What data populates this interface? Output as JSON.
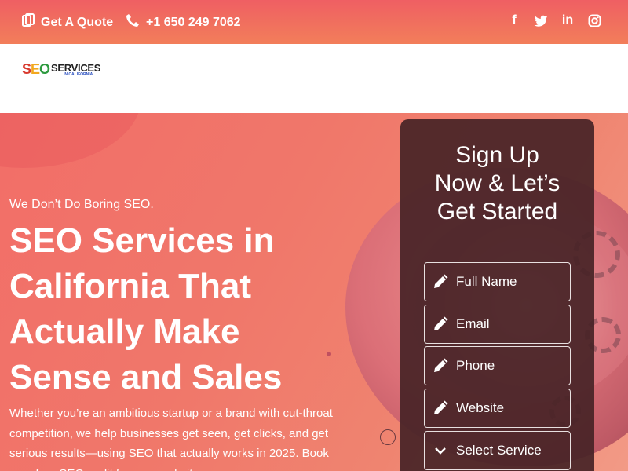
{
  "topbar": {
    "quote_label": "Get A Quote",
    "phone": "+1 650 249 7062",
    "social": [
      {
        "icon": "facebook-icon",
        "glyph": "f"
      },
      {
        "icon": "twitter-icon",
        "glyph": "t"
      },
      {
        "icon": "linkedin-icon",
        "glyph": "in"
      },
      {
        "icon": "instagram-icon",
        "glyph": "◎"
      }
    ]
  },
  "logo": {
    "seo_s": "S",
    "seo_e": "E",
    "seo_o": "O",
    "services": "SERVICES",
    "sub": "IN CALIFORNIA"
  },
  "hero": {
    "tagline": "We Don’t Do Boring SEO.",
    "headline": "SEO Services in California That Actually Make Sense and Sales",
    "lead": "Whether you’re an ambitious startup or a brand with cut-throat competition, we help businesses get seen, get clicks, and get serious results—using SEO that actually works in 2025. Book your free SEO audit for your website"
  },
  "form": {
    "title": "Sign Up Now & Let’s Get Started",
    "full_name": "Full Name",
    "email": "Email",
    "phone": "Phone",
    "website": "Website",
    "service": "Select Service"
  },
  "colors": {
    "topbar_start": "#ef5f63",
    "topbar_end": "#f27e5a",
    "card_bg": "#46232a",
    "seo_red": "#d83a2e",
    "seo_yellow": "#f2a81f",
    "seo_green": "#2d9a3f"
  }
}
